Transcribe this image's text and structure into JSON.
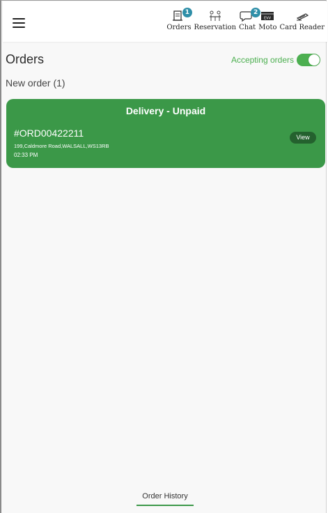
{
  "nav": {
    "items": [
      {
        "label": "Orders",
        "icon": "orders-icon",
        "badge": "1"
      },
      {
        "label": "Reservation",
        "icon": "reservation-icon",
        "badge": ""
      },
      {
        "label": "Chat",
        "icon": "chat-icon",
        "badge": "2"
      },
      {
        "label": "Moto",
        "icon": "moto-card-icon",
        "badge": ""
      },
      {
        "label": "Card Reader",
        "icon": "card-reader-icon",
        "badge": ""
      }
    ],
    "moto_icon_text": "EVV"
  },
  "page": {
    "title": "Orders",
    "accepting_label": "Accepting orders",
    "accepting_enabled": true,
    "new_order_label": "New order (1)"
  },
  "order": {
    "type": "Delivery - Unpaid",
    "id": "#ORD00422211",
    "address": "199,Caldmore Road,WALSALL,WS13RB",
    "time": "02:33 PM",
    "view_label": "View"
  },
  "footer": {
    "order_history_label": "Order History"
  },
  "colors": {
    "accent_green": "#3b9848",
    "toggle_green": "#4caf50",
    "badge_teal": "#2f8fa8",
    "view_button": "#24612e"
  }
}
